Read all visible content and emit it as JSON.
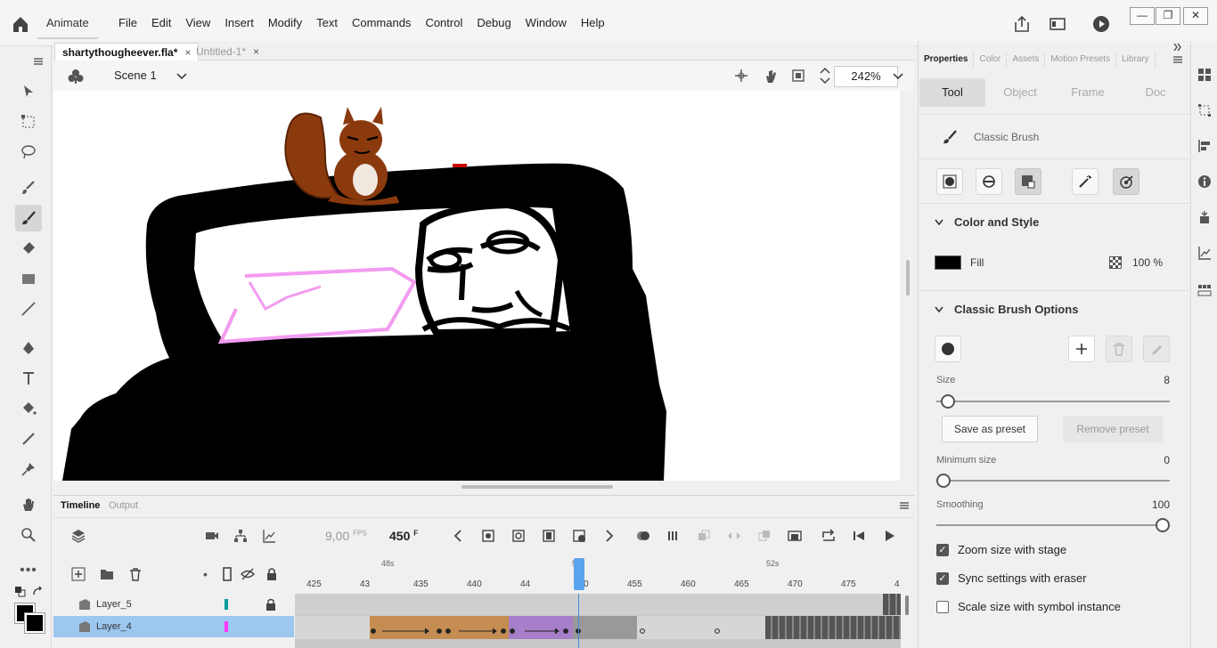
{
  "app": {
    "name": "Animate"
  },
  "menu": [
    "File",
    "Edit",
    "View",
    "Insert",
    "Modify",
    "Text",
    "Commands",
    "Control",
    "Debug",
    "Window",
    "Help"
  ],
  "tabs": [
    {
      "label": "shartythougheever.fla*",
      "active": true
    },
    {
      "label": "Untitled-1*",
      "active": false
    }
  ],
  "scene": {
    "label": "Scene 1",
    "zoom": "242%"
  },
  "timeline": {
    "tabs": [
      "Timeline",
      "Output"
    ],
    "fps": "9,00",
    "fps_unit": "FPS",
    "frame": "450",
    "frame_unit": "F",
    "seconds": [
      "48s",
      "50s",
      "52s"
    ],
    "ticks": [
      "425",
      "43",
      "435",
      "440",
      "44",
      "450",
      "455",
      "460",
      "465",
      "470",
      "475",
      "4"
    ],
    "layers": [
      {
        "name": "Layer_5",
        "color": "#009999",
        "locked": true,
        "selected": false
      },
      {
        "name": "Layer_4",
        "color": "#ff33ff",
        "locked": false,
        "selected": true
      }
    ]
  },
  "properties": {
    "tabs": [
      "Properties",
      "Color",
      "Assets",
      "Motion Presets",
      "Library"
    ],
    "subtabs": [
      "Tool",
      "Object",
      "Frame",
      "Doc"
    ],
    "tool_name": "Classic Brush",
    "color_style": {
      "header": "Color and Style",
      "fill_label": "Fill",
      "fill_color": "#000000",
      "alpha": "100 %"
    },
    "brush_options": {
      "header": "Classic Brush Options",
      "size_label": "Size",
      "size_value": "8",
      "size_fraction": 0.02,
      "save_preset": "Save as preset",
      "remove_preset": "Remove preset",
      "min_size_label": "Minimum size",
      "min_size_value": "0",
      "min_size_fraction": 0,
      "smoothing_label": "Smoothing",
      "smoothing_value": "100",
      "smoothing_fraction": 1,
      "checks": [
        {
          "label": "Zoom size with stage",
          "checked": true
        },
        {
          "label": "Sync settings with eraser",
          "checked": true
        },
        {
          "label": "Scale size with symbol instance",
          "checked": false
        }
      ]
    }
  }
}
